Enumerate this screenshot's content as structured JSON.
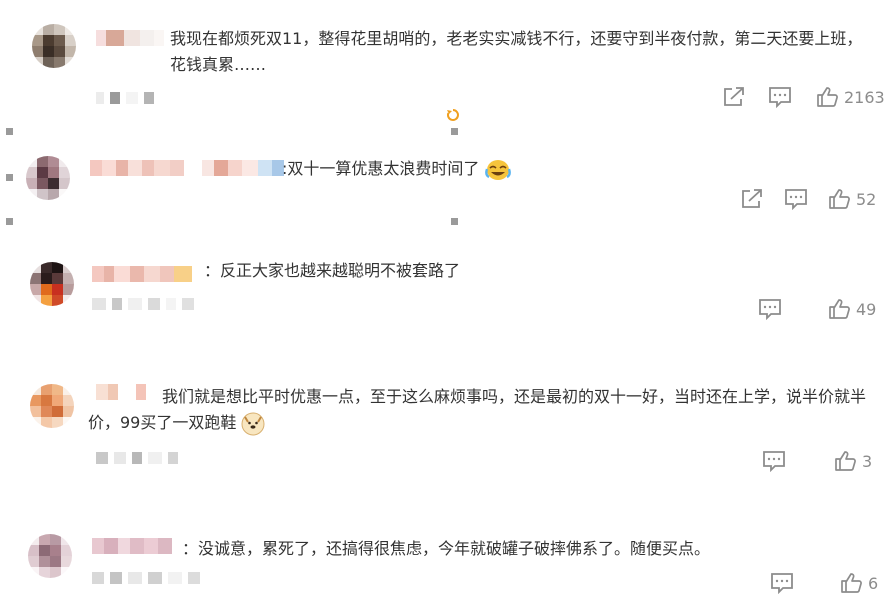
{
  "comments": [
    {
      "text": "我现在都烦死双11，整得花里胡哨的，老老实实减钱不行，还要守到半夜付款，第二天还要上班，花钱真累……",
      "likes": "2163",
      "has_share": true,
      "has_reply": true
    },
    {
      "text": ":双十一算优惠太浪费时间了",
      "emoji": "laugh-cry",
      "likes": "52",
      "has_share": true,
      "has_reply": true
    },
    {
      "text": "：反正大家也越来越聪明不被套路了",
      "likes": "49",
      "has_share": false,
      "has_reply": true
    },
    {
      "text": "我们就是想比平时优惠一点，至于这么麻烦事吗，还是最初的双十一好，当时还在上学，说半价就半价，99买了一双跑鞋",
      "emoji": "doge",
      "likes": "3",
      "has_share": false,
      "has_reply": true
    },
    {
      "text": "：没诚意，累死了，还搞得很焦虑，今年就破罐子破摔佛系了。随便买点。",
      "likes": "6",
      "has_share": false,
      "has_reply": true
    }
  ],
  "icons": {
    "share": "share-icon",
    "reply": "comment-icon",
    "like": "thumbs-up-icon",
    "loading": "loading-spinner-icon"
  },
  "colors": {
    "text": "#333333",
    "muted": "#8c8c8c",
    "accent": "#f0a020"
  }
}
